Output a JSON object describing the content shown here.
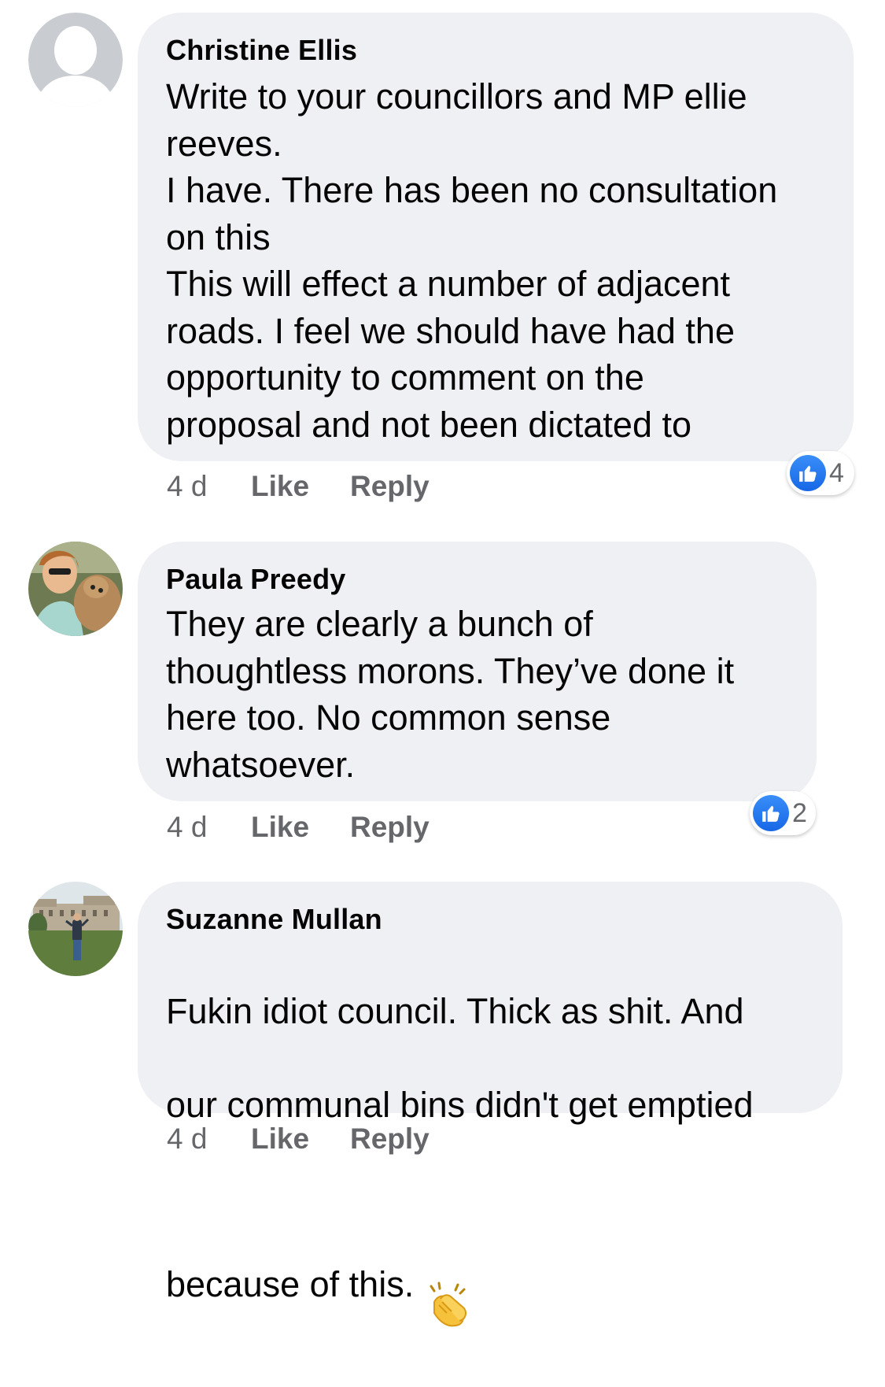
{
  "comments": [
    {
      "author": "Christine Ellis",
      "text": "Write to your councillors  and MP ellie\nreeves.\nI have. There has been no consultation\non this\nThis will effect a number of adjacent\nroads. I feel we should have had the\nopportunity to comment on the\nproposal and not been dictated to",
      "time": "4 d",
      "like_label": "Like",
      "reply_label": "Reply",
      "reaction_count": "4",
      "avatar_icon": "default-profile-silhouette"
    },
    {
      "author": "Paula Preedy",
      "text": "They are clearly a bunch of\nthoughtless morons. They’ve done it\nhere too.  No common sense\nwhatsoever.",
      "time": "4 d",
      "like_label": "Like",
      "reply_label": "Reply",
      "reaction_count": "2",
      "avatar_icon": "profile-photo-woman-with-dog"
    },
    {
      "author": "Suzanne Mullan",
      "text_lines": [
        "Fukin idiot council. Thick as shit. And",
        "our communal bins didn't get emptied",
        "because of this."
      ],
      "emoji": "clapping-hands-emoji",
      "time": "4 d",
      "like_label": "Like",
      "reply_label": "Reply",
      "avatar_icon": "profile-photo-person-in-front-of-building"
    }
  ],
  "colors": {
    "bubble": "#eff0f4",
    "meta_text": "#65676b",
    "like_blue": "#1877f2"
  }
}
